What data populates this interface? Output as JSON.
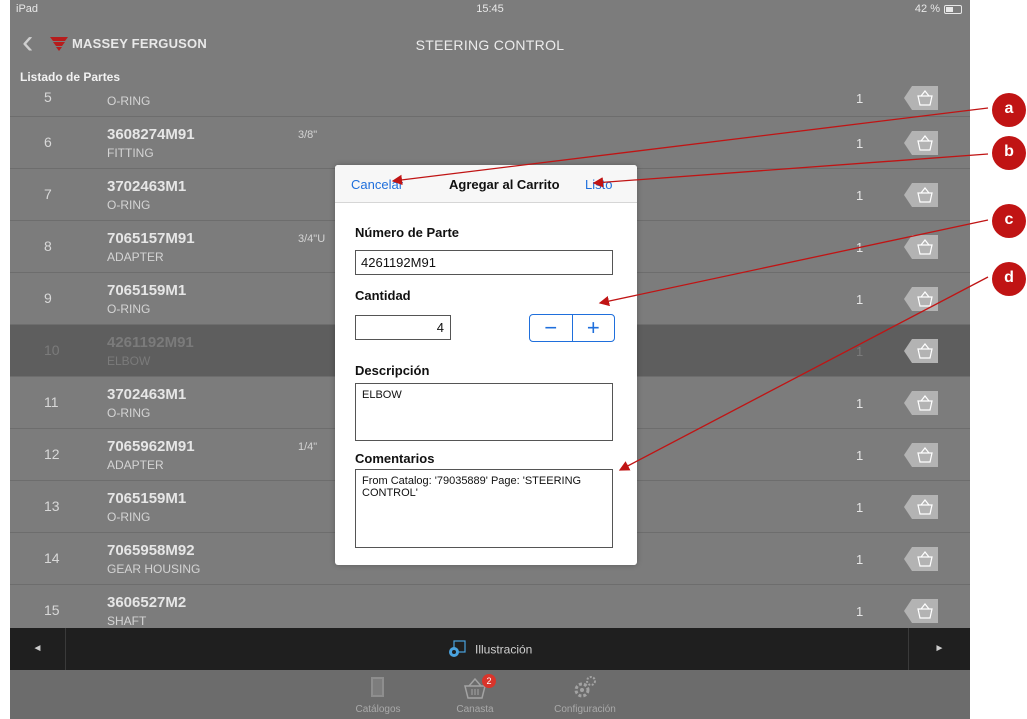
{
  "status": {
    "device": "iPad",
    "time": "15:45",
    "battery": "42 %"
  },
  "nav": {
    "brand": "MASSEY FERGUSON",
    "title": "STEERING CONTROL"
  },
  "list": {
    "header": "Listado de Partes",
    "rows": [
      {
        "num": "5",
        "part": "",
        "desc": "O-RING",
        "note": "",
        "qty": "1"
      },
      {
        "num": "6",
        "part": "3608274M91",
        "desc": "FITTING",
        "note": "3/8\"",
        "qty": "1"
      },
      {
        "num": "7",
        "part": "3702463M1",
        "desc": "O-RING",
        "note": "",
        "qty": "1"
      },
      {
        "num": "8",
        "part": "7065157M91",
        "desc": "ADAPTER",
        "note": "3/4\"U",
        "qty": "1"
      },
      {
        "num": "9",
        "part": "7065159M1",
        "desc": "O-RING",
        "note": "",
        "qty": "1"
      },
      {
        "num": "10",
        "part": "4261192M91",
        "desc": "ELBOW",
        "note": "",
        "qty": "1"
      },
      {
        "num": "11",
        "part": "3702463M1",
        "desc": "O-RING",
        "note": "",
        "qty": "1"
      },
      {
        "num": "12",
        "part": "7065962M91",
        "desc": "ADAPTER",
        "note": "1/4\"",
        "qty": "1"
      },
      {
        "num": "13",
        "part": "7065159M1",
        "desc": "O-RING",
        "note": "",
        "qty": "1"
      },
      {
        "num": "14",
        "part": "7065958M92",
        "desc": "GEAR HOUSING",
        "note": "",
        "qty": "1"
      },
      {
        "num": "15",
        "part": "3606527M2",
        "desc": "SHAFT",
        "note": "",
        "qty": "1"
      }
    ]
  },
  "toolbar": {
    "prev": "◄",
    "center": "Illustración",
    "next": "►"
  },
  "tabs": {
    "catalogs": "Catálogos",
    "cart": "Canasta",
    "cart_badge": "2",
    "settings": "Configuración"
  },
  "modal": {
    "cancel": "Cancelar",
    "title": "Agregar al Carrito",
    "done": "Listo",
    "part_label": "Número de Parte",
    "part_value": "4261192M91",
    "qty_label": "Cantidad",
    "qty_value": "4",
    "minus": "−",
    "plus": "+",
    "desc_label": "Descripción",
    "desc_value": "ELBOW",
    "comments_label": "Comentarios",
    "comments_value": "From Catalog: '79035889' Page: 'STEERING CONTROL'"
  },
  "callouts": [
    "a",
    "b",
    "c",
    "d"
  ],
  "colors": {
    "accent": "#1f6fdc",
    "callout": "#c01414",
    "badge": "#d9342b",
    "background": "#7c7c7c"
  }
}
